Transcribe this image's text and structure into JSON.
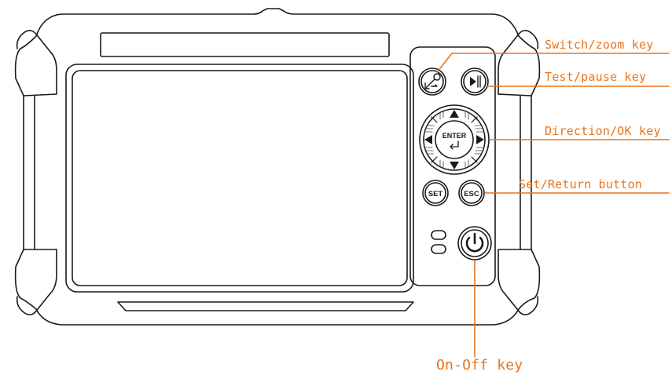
{
  "colors": {
    "outline": "#1a1a1a",
    "callout": "#e8741c",
    "background": "#ffffff"
  },
  "device": {
    "buttons": {
      "switch_zoom": {
        "icon": "magnifier-arrows-icon"
      },
      "test_pause": {
        "icon": "play-pause-icon"
      },
      "direction_pad": {
        "center_label": "ENTER",
        "center_icon": "return-arrow-icon",
        "arrows": [
          "up",
          "down",
          "left",
          "right"
        ]
      },
      "set_label": "SET",
      "esc_label": "ESC",
      "power": {
        "icon": "power-icon"
      }
    },
    "indicator_leds": 2
  },
  "callouts": {
    "switch_zoom": "Switch/zoom key",
    "test_pause": "Test/pause key",
    "direction_ok": "Direction/OK key",
    "set_return": "Set/Return button",
    "on_off": "On-Off key"
  }
}
